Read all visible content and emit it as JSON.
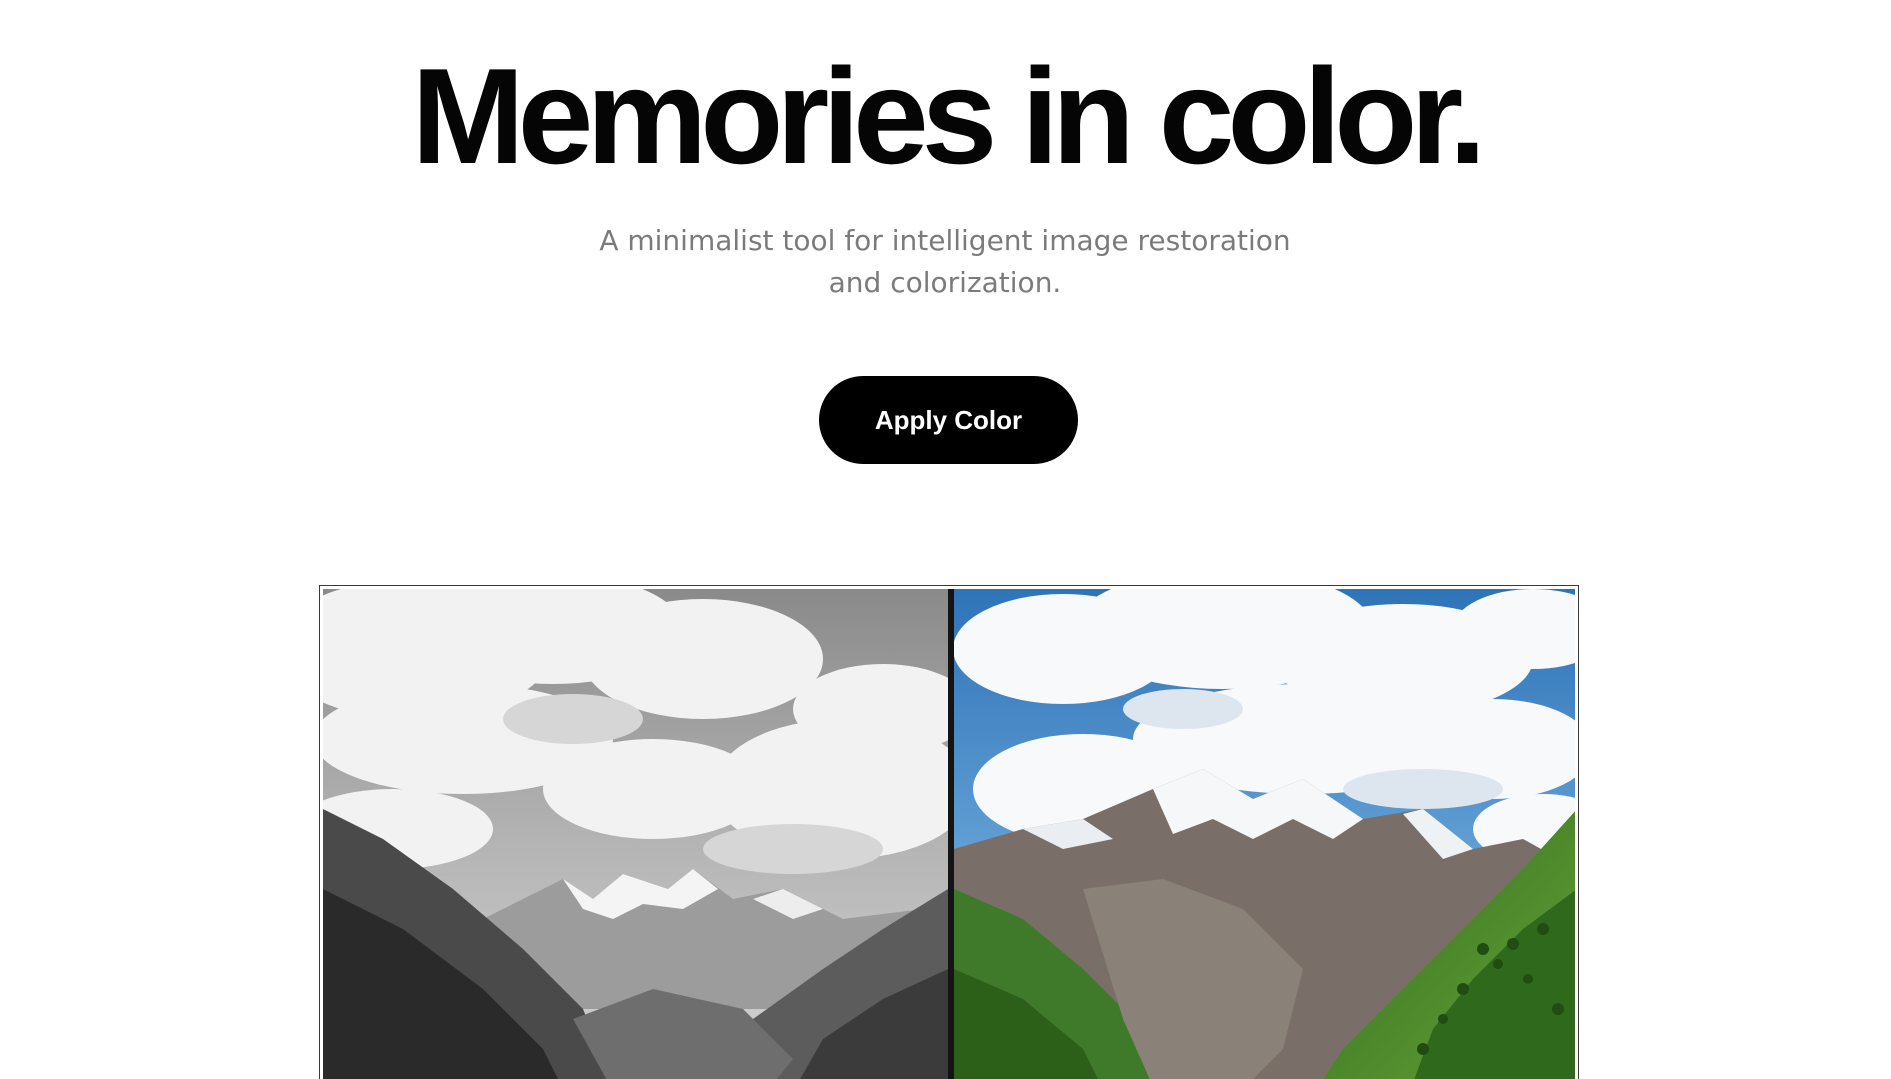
{
  "hero": {
    "title": "Memories in color.",
    "subtitle": "A minimalist tool for intelligent image restoration and colorization."
  },
  "actions": {
    "apply_label": "Apply Color"
  },
  "comparison": {
    "before_label": "black and white mountain landscape",
    "after_label": "colorized mountain landscape",
    "divider_position": 0.5
  },
  "colors": {
    "text_primary": "#050505",
    "text_secondary": "#7b7b7b",
    "button_bg": "#000000",
    "button_text": "#ffffff",
    "sky_blue": "#3f86c6",
    "grass_green": "#3f8a2a"
  }
}
